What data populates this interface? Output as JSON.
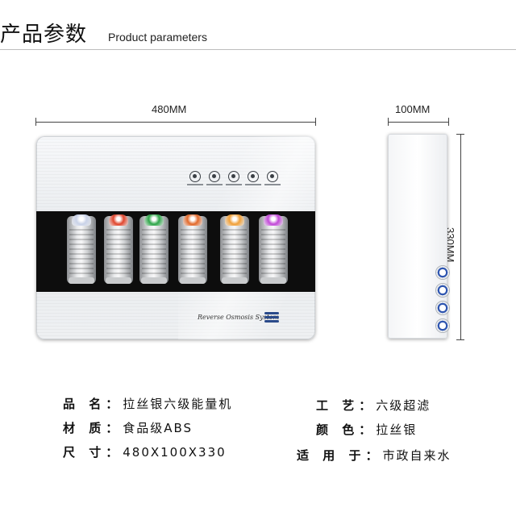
{
  "header": {
    "title_cn": "产品参数",
    "title_en": "Product parameters"
  },
  "dimensions": {
    "width": "480MM",
    "depth": "100MM",
    "height": "330MM"
  },
  "product": {
    "brand_text": "Reverse Osmosis System",
    "control_icons": [
      "mode-icon",
      "wash-icon",
      "filter-icon",
      "power-icon",
      "settings-icon"
    ],
    "cartridge_cap_colors": [
      "#c9d2e8",
      "#e0462e",
      "#2fa64a",
      "#e26a2c",
      "#f0a03a",
      "#c24ad8"
    ]
  },
  "specs": {
    "left": [
      {
        "key": "品 名：",
        "value": "拉丝银六级能量机"
      },
      {
        "key": "材 质：",
        "value": "食品级ABS"
      },
      {
        "key": "尺 寸：",
        "value": "480X100X330"
      }
    ],
    "right": [
      {
        "key": "工 艺：",
        "value": "六级超滤"
      },
      {
        "key": "颜 色：",
        "value": "拉丝银"
      },
      {
        "key": "适 用 于：",
        "value": "市政自来水"
      }
    ]
  }
}
